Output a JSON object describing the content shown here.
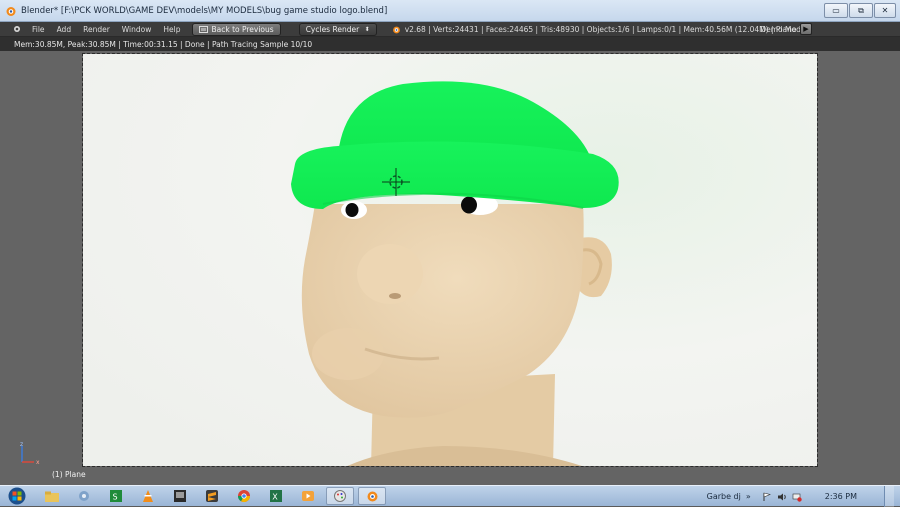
{
  "window": {
    "title": "Blender* [F:\\PCK WORLD\\GAME DEV\\models\\MY MODELS\\bug game studio logo.blend]",
    "minimize_label": "▭",
    "maximize_label": "⧉",
    "close_label": "✕"
  },
  "menu": [
    "File",
    "Add",
    "Render",
    "Window",
    "Help"
  ],
  "back_button": {
    "label": "Back to Previous"
  },
  "render_engine": {
    "value": "Cycles Render",
    "options_visible": false
  },
  "stats": "v2.68 | Verts:24431 | Faces:24465 | Tris:48930 | Objects:1/6 | Lamps:0/1 | Mem:40.56M (12.04M) | Plane",
  "demo_mode": {
    "label": "Demo Mode:",
    "play_label": "▶"
  },
  "render_status": "Mem:30.85M, Peak:30.85M | Time:00:31.15 | Done | Path Tracing Sample 10/10",
  "viewport": {
    "object_label": "(1) Plane",
    "axis_x": "x",
    "axis_z": "z"
  },
  "taskbar": {
    "apps": [
      "explorer",
      "control-panel",
      "excel-green",
      "vlc",
      "media",
      "sublime",
      "chrome",
      "excel",
      "video",
      "paint",
      "blender"
    ],
    "active_app": "blender",
    "tray_user": "Garbe dj",
    "tray_chevron": "»",
    "clock": "2:36 PM"
  },
  "colors": {
    "hat": "#14f05a",
    "skin": "#ead1ad",
    "background": "#f3f4f1",
    "ui_dark": "#3c3c3c",
    "taskbar": "#a9c2e1"
  }
}
